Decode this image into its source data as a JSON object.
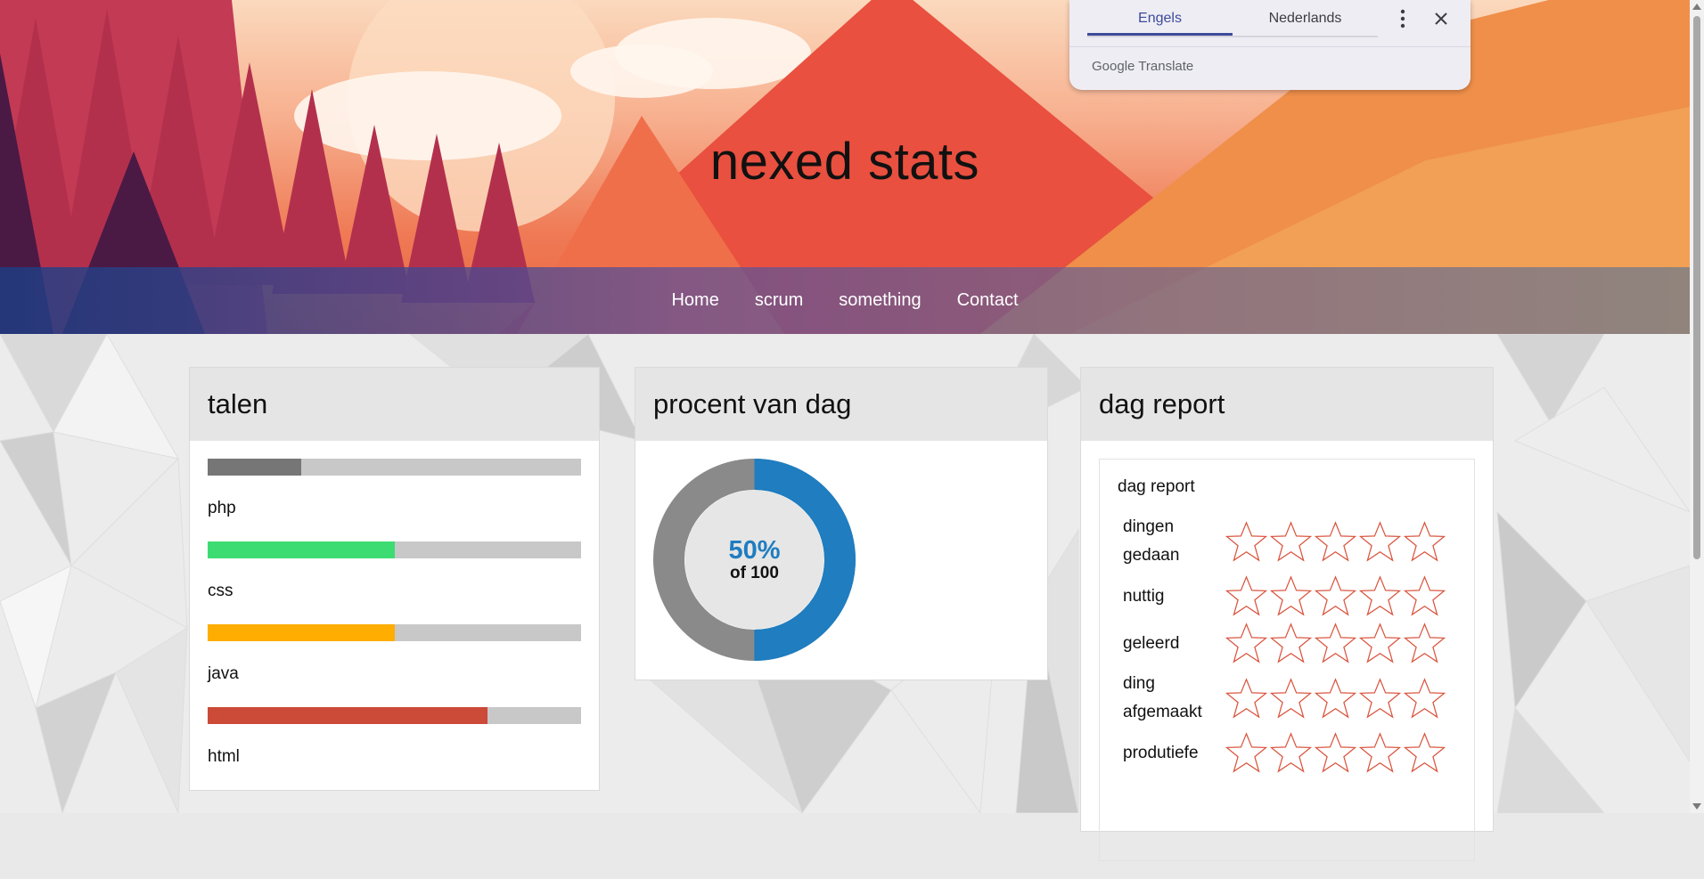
{
  "site": {
    "title": "nexed stats"
  },
  "nav": {
    "items": [
      "Home",
      "scrum",
      "something",
      "Contact"
    ]
  },
  "cards": {
    "talen": {
      "title": "talen",
      "bars": [
        {
          "label": "php",
          "percent": 25,
          "color": "#767676"
        },
        {
          "label": "css",
          "percent": 50,
          "color": "#3ddc72"
        },
        {
          "label": "java",
          "percent": 50,
          "color": "#ffad00"
        },
        {
          "label": "html",
          "percent": 75,
          "color": "#cc4a38"
        }
      ]
    },
    "procent": {
      "title": "procent van dag",
      "value_percent": 50,
      "value_text": "50%",
      "of_text": "of 100",
      "fill_color": "#1f7dc0",
      "rest_color": "#8a8a8a"
    },
    "report": {
      "title": "dag report",
      "box_title": "dag report",
      "ratings": [
        {
          "label": "dingen gedaan",
          "stars": 0
        },
        {
          "label": "nuttig",
          "stars": 0
        },
        {
          "label": "geleerd",
          "stars": 0
        },
        {
          "label": "ding afgemaakt",
          "stars": 0
        },
        {
          "label": "produtiefe",
          "stars": 0
        }
      ],
      "max_stars": 5,
      "star_color": "#d9533c"
    }
  },
  "translate": {
    "tabs": [
      "Engels",
      "Nederlands"
    ],
    "active_tab": "Engels",
    "brand_google": "Google",
    "brand_translate": "Translate"
  }
}
